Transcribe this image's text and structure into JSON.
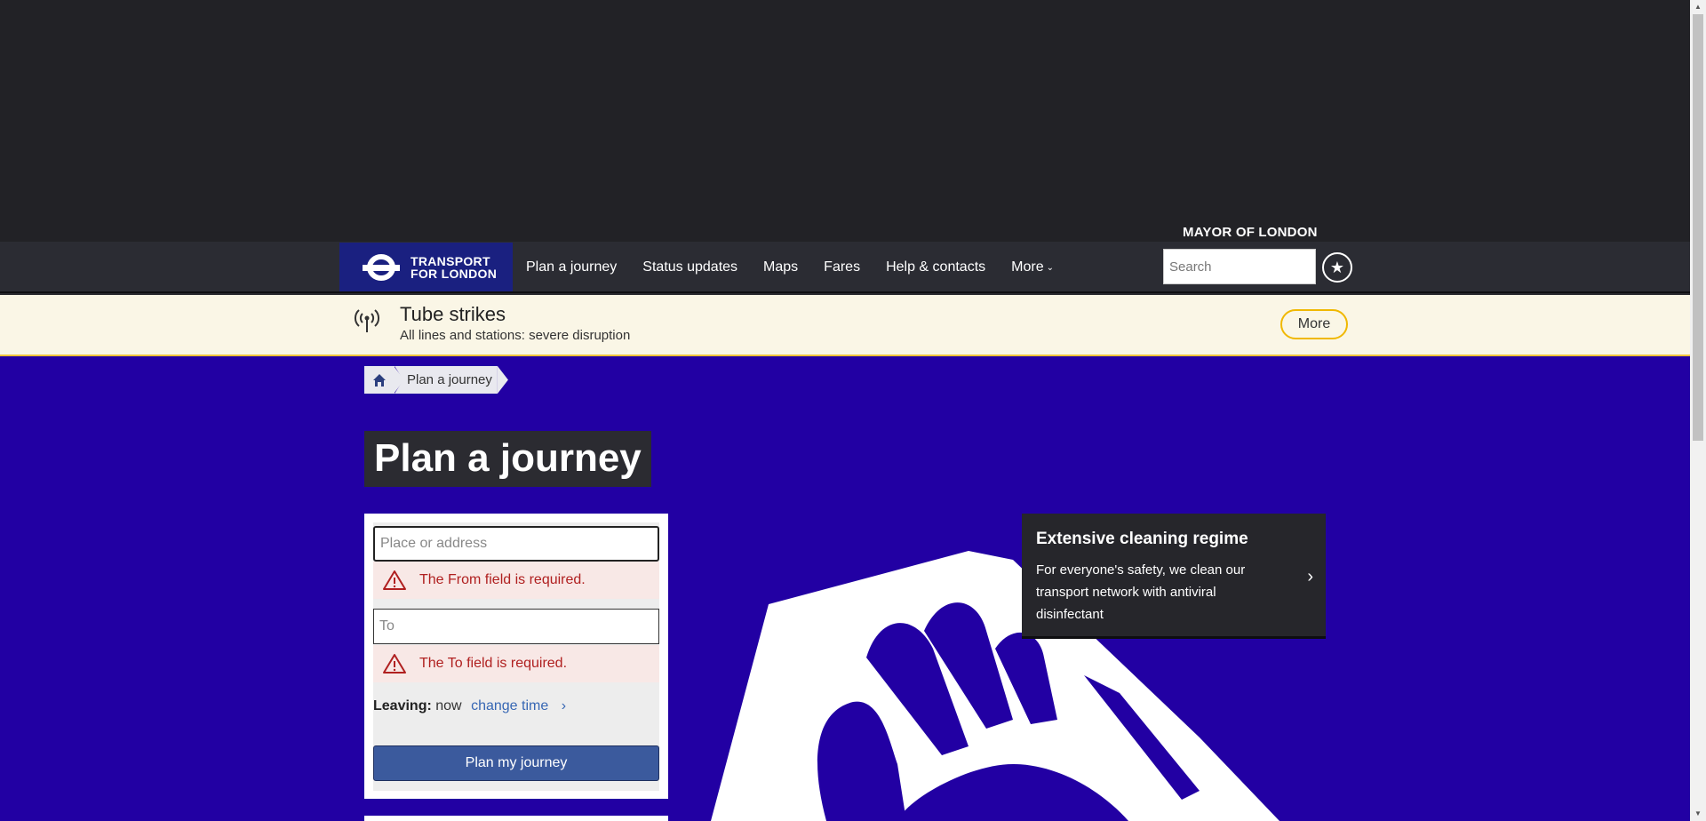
{
  "header": {
    "mayor_label": "MAYOR OF LONDON",
    "logo_line1": "TRANSPORT",
    "logo_line2": "FOR LONDON",
    "nav": [
      "Plan a journey",
      "Status updates",
      "Maps",
      "Fares",
      "Help & contacts"
    ],
    "more_label": "More",
    "search_placeholder": "Search"
  },
  "alert": {
    "title": "Tube strikes",
    "subtitle": "All lines and stations: severe disruption",
    "more_label": "More"
  },
  "breadcrumb": {
    "current": "Plan a journey"
  },
  "page": {
    "title": "Plan a journey"
  },
  "form": {
    "from_placeholder": "Place or address",
    "from_error": "The From field is required.",
    "to_placeholder": "To",
    "to_error": "The To field is required.",
    "leaving_label": "Leaving:",
    "leaving_value": "now",
    "change_time_label": "change time",
    "submit_label": "Plan my journey"
  },
  "promo": {
    "title": "Extensive cleaning regime",
    "text": "For everyone's safety, we clean our transport network with antiviral disinfectant"
  },
  "colors": {
    "brand_blue": "#2200a3",
    "logo_blue": "#1a2080",
    "error_red": "#b02020",
    "alert_yellow": "#f0c23a"
  }
}
